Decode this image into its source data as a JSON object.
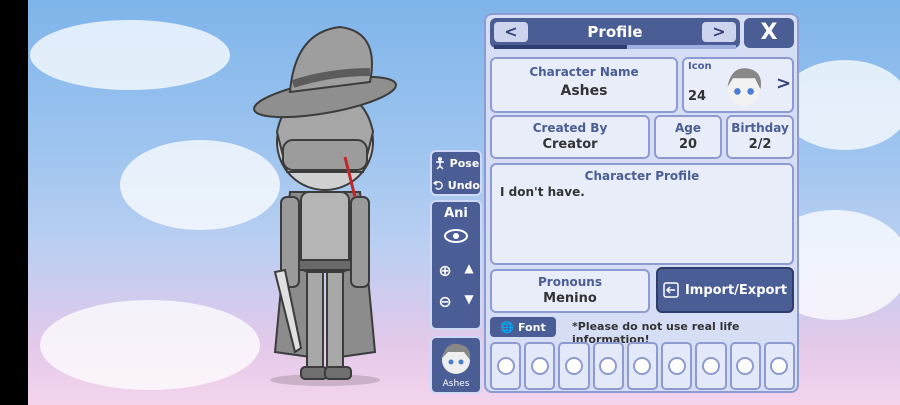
{
  "panel": {
    "title": "Profile",
    "close_label": "X",
    "prev_label": "<",
    "next_label": ">"
  },
  "character_name": {
    "label": "Character Name",
    "value": "Ashes"
  },
  "icon": {
    "label": "Icon",
    "number": "24",
    "next": ">"
  },
  "created_by": {
    "label": "Created By",
    "value": "Creator"
  },
  "age": {
    "label": "Age",
    "value": "20"
  },
  "birthday": {
    "label": "Birthday",
    "value": "2/2"
  },
  "profile": {
    "label": "Character Profile",
    "text": "I don't have."
  },
  "pronouns": {
    "label": "Pronouns",
    "value": "Menino"
  },
  "buttons": {
    "import_export": "Import/Export",
    "font": "Font"
  },
  "notice": "*Please do not use real life information!",
  "tools": {
    "pose": "Pose",
    "undo": "Undo",
    "ani": "Ani"
  },
  "thumbnail": {
    "name": "Ashes"
  },
  "colors": {
    "accent": "#4a5d95",
    "panel": "#d6def5",
    "card": "#e9edfa"
  }
}
